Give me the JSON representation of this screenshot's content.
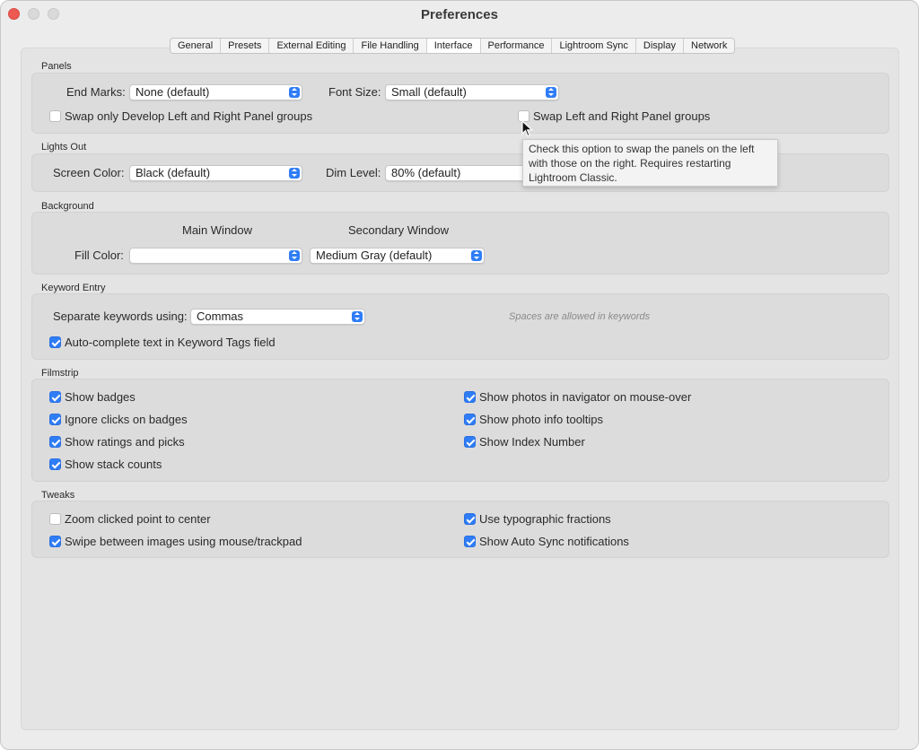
{
  "window": {
    "title": "Preferences"
  },
  "tabs": [
    "General",
    "Presets",
    "External Editing",
    "File Handling",
    "Interface",
    "Performance",
    "Lightroom Sync",
    "Display",
    "Network"
  ],
  "active_tab": "Interface",
  "panels": {
    "section": "Panels",
    "end_marks_label": "End Marks:",
    "end_marks_value": "None (default)",
    "font_size_label": "Font Size:",
    "font_size_value": "Small (default)",
    "swap_develop_label": "Swap only Develop Left and Right Panel groups",
    "swap_develop_checked": false,
    "swap_panels_label": "Swap Left and Right Panel groups",
    "swap_panels_checked": false
  },
  "tooltip": {
    "text": "Check this option to swap the panels on the left with those on the right. Requires restarting Lightroom Classic."
  },
  "lights_out": {
    "section": "Lights Out",
    "screen_color_label": "Screen Color:",
    "screen_color_value": "Black (default)",
    "dim_level_label": "Dim Level:",
    "dim_level_value": "80% (default)"
  },
  "background": {
    "section": "Background",
    "main_window_header": "Main Window",
    "secondary_window_header": "Secondary Window",
    "fill_color_label": "Fill Color:",
    "main_fill_value": "",
    "secondary_fill_value": "Medium Gray (default)"
  },
  "keyword_entry": {
    "section": "Keyword Entry",
    "separate_label": "Separate keywords using:",
    "separate_value": "Commas",
    "spaces_note": "Spaces are allowed in keywords",
    "autocomplete_label": "Auto-complete text in Keyword Tags field",
    "autocomplete_checked": true
  },
  "filmstrip": {
    "section": "Filmstrip",
    "left": [
      {
        "label": "Show badges",
        "checked": true
      },
      {
        "label": "Ignore clicks on badges",
        "checked": true
      },
      {
        "label": "Show ratings and picks",
        "checked": true
      },
      {
        "label": "Show stack counts",
        "checked": true
      }
    ],
    "right": [
      {
        "label": "Show photos in navigator on mouse-over",
        "checked": true
      },
      {
        "label": "Show photo info tooltips",
        "checked": true
      },
      {
        "label": "Show Index Number",
        "checked": true
      }
    ]
  },
  "tweaks": {
    "section": "Tweaks",
    "left": [
      {
        "label": "Zoom clicked point to center",
        "checked": false
      },
      {
        "label": "Swipe between images using mouse/trackpad",
        "checked": true
      }
    ],
    "right": [
      {
        "label": "Use typographic fractions",
        "checked": true
      },
      {
        "label": "Show Auto Sync notifications",
        "checked": true
      }
    ]
  },
  "colors": {
    "accent": "#2f7df6",
    "close": "#ee5a52"
  }
}
